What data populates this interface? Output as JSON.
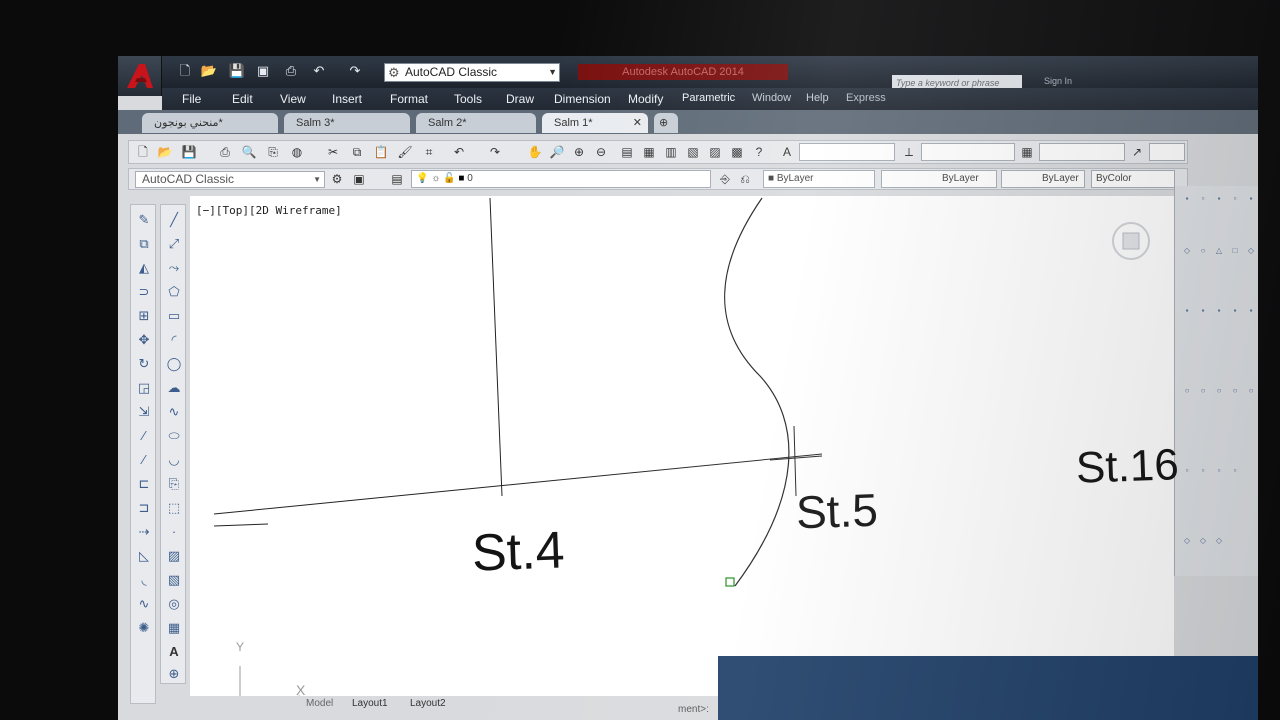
{
  "app": {
    "workspace": "AutoCAD Classic",
    "title": "Autodesk AutoCAD 2014",
    "search_placeholder": "Type a keyword or phrase",
    "sign_in": "Sign In"
  },
  "menu": [
    "File",
    "Edit",
    "View",
    "Insert",
    "Format",
    "Tools",
    "Draw",
    "Dimension",
    "Modify",
    "Parametric",
    "Window",
    "Help",
    "Express"
  ],
  "doc_tabs": [
    {
      "label": "منحني بونجون*"
    },
    {
      "label": "Salm 3*"
    },
    {
      "label": "Salm 2*"
    },
    {
      "label": "Salm 1*",
      "active": true
    }
  ],
  "layers": {
    "workspace_combo": "AutoCAD Classic",
    "layer_name": "0",
    "color": "ByLayer",
    "linetype": "ByLayer",
    "lineweight": "ByLayer",
    "plotstyle": "ByColor"
  },
  "viewport": {
    "label": "[−][Top][2D Wireframe]"
  },
  "drawing_labels": {
    "st4": "St.4",
    "st5": "St.5",
    "st16": "St.16"
  },
  "ucs": {
    "x": "X",
    "y": "Y"
  },
  "layout_tabs": {
    "model": "Model",
    "layout1": "Layout1",
    "layout2": "Layout2"
  },
  "command_line": "ment>:",
  "colors": {
    "accent_red": "#c8141a",
    "titlebar": "#2f3946",
    "canvas": "#ffffff"
  }
}
